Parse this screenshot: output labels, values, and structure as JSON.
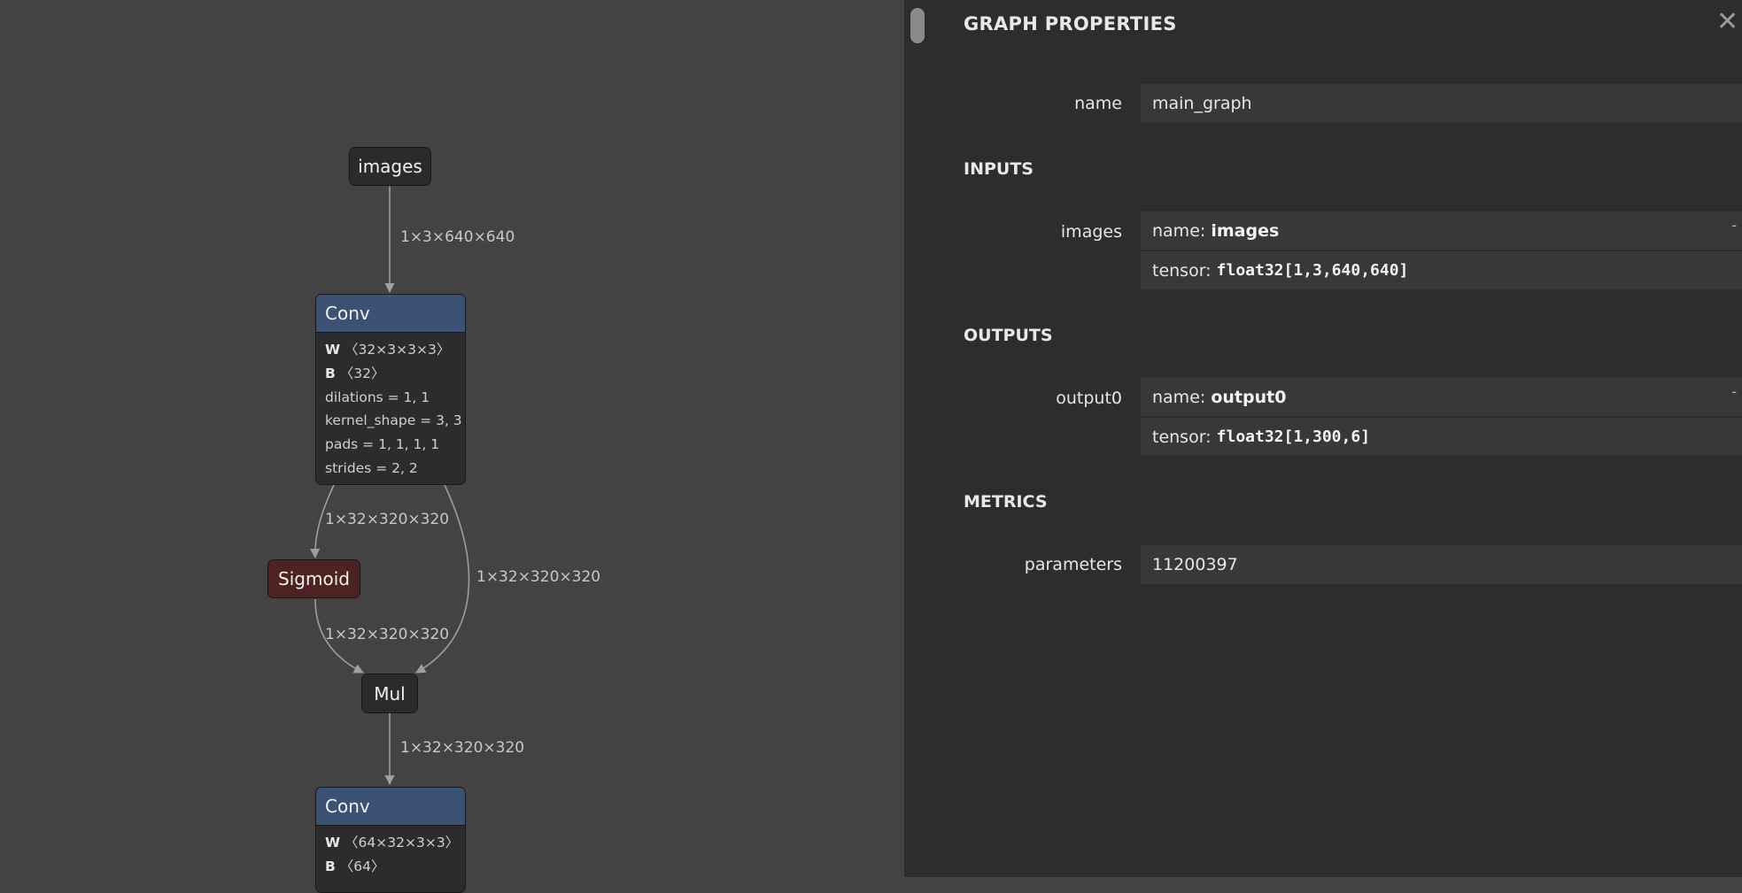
{
  "graph": {
    "nodes": {
      "images": "images",
      "conv1": {
        "title": "Conv",
        "attrs": [
          {
            "key": "W",
            "value": "〈32×3×3×3〉"
          },
          {
            "key": "B",
            "value": "〈32〉"
          },
          {
            "key": "",
            "value": "dilations = 1, 1"
          },
          {
            "key": "",
            "value": "kernel_shape = 3, 3"
          },
          {
            "key": "",
            "value": "pads = 1, 1, 1, 1"
          },
          {
            "key": "",
            "value": "strides = 2, 2"
          }
        ]
      },
      "sigmoid": "Sigmoid",
      "mul": "Mul",
      "conv2": {
        "title": "Conv",
        "attrs": [
          {
            "key": "W",
            "value": "〈64×32×3×3〉"
          },
          {
            "key": "B",
            "value": "〈64〉"
          }
        ]
      }
    },
    "edge_labels": {
      "images_conv1": "1×3×640×640",
      "conv1_sigmoid": "1×32×320×320",
      "conv1_mul": "1×32×320×320",
      "sigmoid_mul": "1×32×320×320",
      "mul_conv2": "1×32×320×320"
    }
  },
  "panel": {
    "title": "GRAPH PROPERTIES",
    "name_label": "name",
    "name_value": "main_graph",
    "inputs_title": "INPUTS",
    "inputs": [
      {
        "label": "images",
        "name_prefix": "name: ",
        "name": "images",
        "tensor_prefix": "tensor: ",
        "tensor": "float32[1,3,640,640]",
        "expander": "-"
      }
    ],
    "outputs_title": "OUTPUTS",
    "outputs": [
      {
        "label": "output0",
        "name_prefix": "name: ",
        "name": "output0",
        "tensor_prefix": "tensor: ",
        "tensor": "float32[1,300,6]",
        "expander": "-"
      }
    ],
    "metrics_title": "METRICS",
    "metrics": [
      {
        "label": "parameters",
        "value": "11200397"
      }
    ],
    "close_icon": "✕"
  },
  "colors": {
    "canvas": "#434343",
    "panel": "#2d2d2d",
    "conv_header": "#3b5275",
    "sigmoid": "#4e2220",
    "edge": "#9e9e9e"
  }
}
